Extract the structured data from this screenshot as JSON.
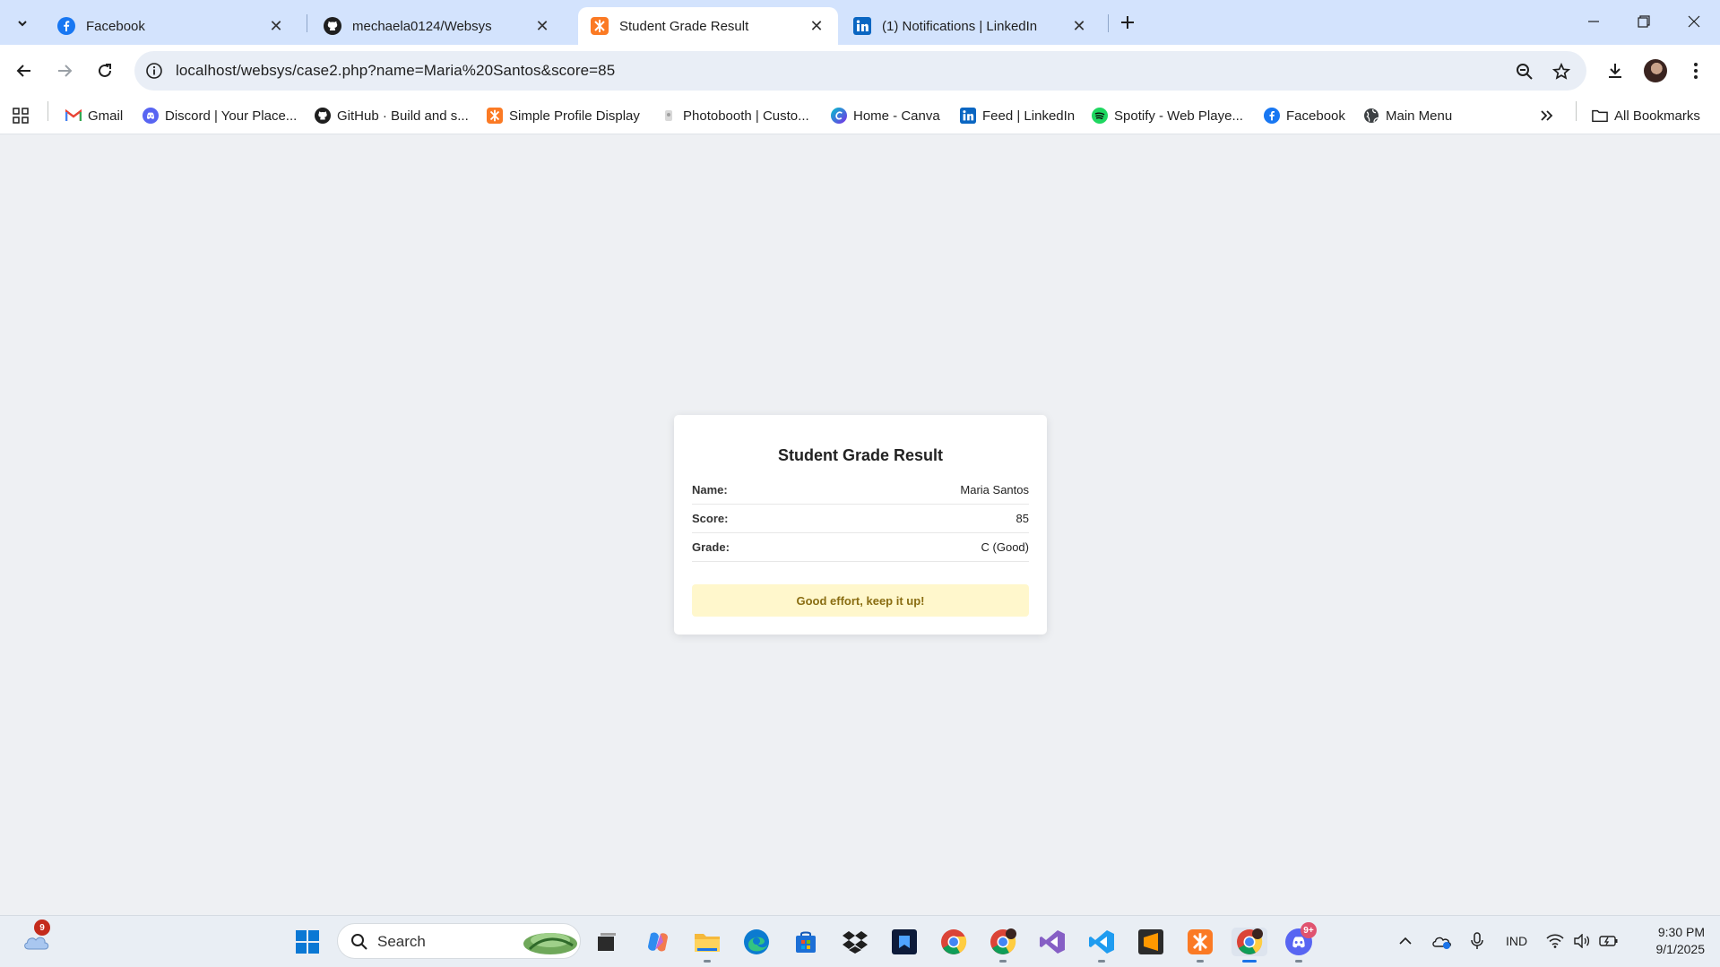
{
  "browser": {
    "tabs": [
      {
        "title": "Facebook",
        "icon": "facebook-icon"
      },
      {
        "title": "mechaela0124/Websys",
        "icon": "github-icon"
      },
      {
        "title": "Student Grade Result",
        "icon": "xampp-icon",
        "active": true
      },
      {
        "title": "(1) Notifications | LinkedIn",
        "icon": "linkedin-icon"
      }
    ],
    "url": "localhost/websys/case2.php?name=Maria%20Santos&score=85",
    "bookmarks": [
      {
        "label": "Gmail",
        "icon": "gmail-icon"
      },
      {
        "label": "Discord | Your Place...",
        "icon": "discord-icon"
      },
      {
        "label": "GitHub · Build and s...",
        "icon": "github-icon"
      },
      {
        "label": "Simple Profile Display",
        "icon": "xampp-icon"
      },
      {
        "label": "Photobooth | Custo...",
        "icon": "photobooth-icon"
      },
      {
        "label": "Home - Canva",
        "icon": "canva-icon"
      },
      {
        "label": "Feed | LinkedIn",
        "icon": "linkedin-icon"
      },
      {
        "label": "Spotify - Web Playe...",
        "icon": "spotify-icon"
      },
      {
        "label": "Facebook",
        "icon": "facebook-icon"
      },
      {
        "label": "Main Menu",
        "icon": "globe-icon"
      }
    ],
    "all_bookmarks": "All Bookmarks"
  },
  "result": {
    "heading": "Student Grade Result",
    "name_label": "Name:",
    "name_value": "Maria Santos",
    "score_label": "Score:",
    "score_value": "85",
    "grade_label": "Grade:",
    "grade_value": "C (Good)",
    "message": "Good effort, keep it up!"
  },
  "taskbar": {
    "weather_badge": "9",
    "search_placeholder": "Search",
    "discord_badge": "9+",
    "language": "IND",
    "time": "9:30 PM",
    "date": "9/1/2025"
  },
  "colors": {
    "tabstrip": "#d3e3fd",
    "page_bg": "#eef0f3",
    "message_bg": "#fff7cc",
    "message_text": "#8a6d12"
  }
}
